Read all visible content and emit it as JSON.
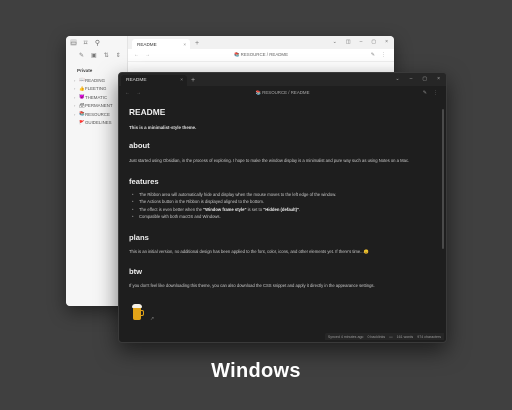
{
  "light_window": {
    "vault_name": "Private",
    "sidebar_items": [
      {
        "icon": "📖",
        "label": "READING"
      },
      {
        "icon": "👍",
        "label": "FLEETING"
      },
      {
        "icon": "😈",
        "label": "THEMATIC"
      },
      {
        "icon": "🗃",
        "label": "PERMANENT"
      },
      {
        "icon": "📚",
        "label": "RESOURCE"
      },
      {
        "icon": "🚩",
        "label": "GUIDELINES"
      }
    ],
    "tab_label": "README",
    "breadcrumb": "📚 RESOURCE / README"
  },
  "dark_window": {
    "tab_label": "README",
    "breadcrumb": "📚 RESOURCE / README",
    "title": "README",
    "intro": "This is a minimalist-style theme.",
    "sections": {
      "about": {
        "heading": "about",
        "text": "Just started using Obsidian, in the process of exploring. I hope to make the window display is a minimalist and pure way such as using Notes on a Mac."
      },
      "features": {
        "heading": "features",
        "items": [
          "The Ribbon area will automatically hide and display when the mouse moves to the left edge of the window.",
          "The Actions button in the Ribbon is displayed aligned to the bottom."
        ],
        "item3_prefix": "The effect is even better when the ",
        "item3_bold1": "\"Window frame style\"",
        "item3_mid": " is set to ",
        "item3_bold2": "\"Hidden (default)\"",
        "item3_suffix": ".",
        "item4": "Compatible with both macOS and Windows."
      },
      "plans": {
        "heading": "plans",
        "text": "This is an initial version, no additional design has been applied to the font, color, icons, and other elements yet. If there's time...😊"
      },
      "btw": {
        "heading": "btw",
        "text": "If you don't feel like downloading this theme, you can also download the CSS snippet and apply it directly in the appearance settings."
      }
    },
    "status": {
      "synced": "Synced 4 minutes ago",
      "backlinks": "0 backlinks",
      "words": "161 words",
      "characters": "974 characters"
    }
  },
  "caption": "Windows",
  "colors": {
    "background": "#404040",
    "dark_editor": "#1e1e1e",
    "light_editor": "#ffffff",
    "beer": "#e3a418"
  }
}
